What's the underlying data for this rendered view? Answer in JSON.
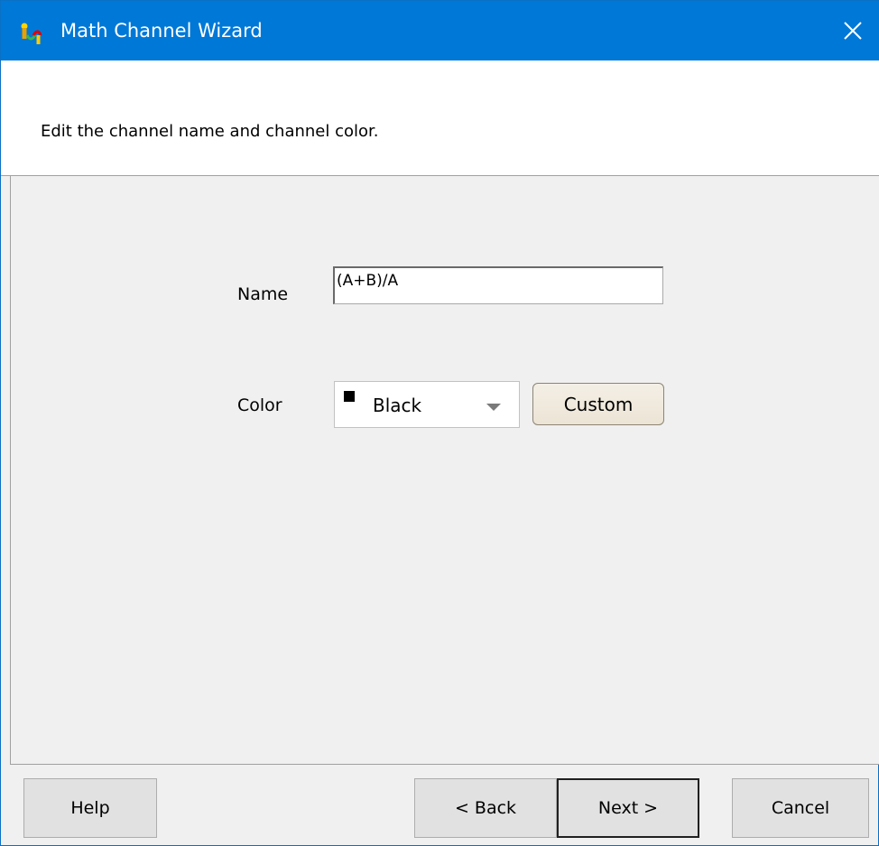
{
  "window": {
    "title": "Math Channel Wizard",
    "app_icon": "math-channel-wizard-icon",
    "close_icon": "close-icon"
  },
  "header": {
    "instruction": "Edit the channel name and channel color."
  },
  "form": {
    "name_label": "Name",
    "name_value": "(A+B)/A",
    "color_label": "Color",
    "color_selected": "Black",
    "color_swatch": "#000000",
    "custom_button": "Custom"
  },
  "buttons": {
    "help": "Help",
    "back": "< Back",
    "next": "Next >",
    "cancel": "Cancel"
  },
  "colors": {
    "titlebar": "#0078d7",
    "panel": "#f0f0f0",
    "header_bg": "#ffffff"
  }
}
